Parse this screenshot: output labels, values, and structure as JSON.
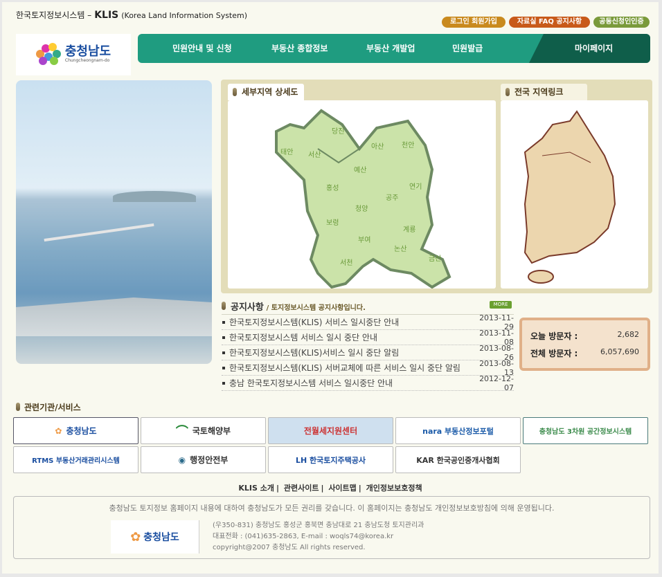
{
  "header": {
    "site_title_kr": "한국토지정보시스템 –",
    "site_title_en": "KLIS",
    "site_title_full": "(Korea Land Information System)",
    "top_buttons": [
      {
        "label": "로그인 회원가입",
        "color": "#c98a1e"
      },
      {
        "label": "자료실 FAQ 공지사항",
        "color": "#c85a1a"
      },
      {
        "label": "공동신청인인증",
        "color": "#7a9a3a"
      }
    ],
    "logo": {
      "name": "충청남도",
      "sub": "Chungcheongnam-do"
    }
  },
  "nav": {
    "items": [
      "민원안내 및 신청",
      "부동산 종합정보",
      "부동산 개발업",
      "민원발급"
    ],
    "mypage": "마이페이지"
  },
  "maps": {
    "detail_tab": "세부지역 상세도",
    "national_tab": "전국 지역링크",
    "regions": [
      "당진",
      "태안",
      "서산",
      "아산",
      "천안",
      "예산",
      "홍성",
      "연기",
      "공주",
      "청양",
      "보령",
      "계룡",
      "부여",
      "논산",
      "서천",
      "금산"
    ]
  },
  "notice": {
    "title": "공지사항",
    "subtitle": "/ 토지정보시스템 공지사항입니다.",
    "more": "MORE",
    "items": [
      {
        "title": "한국토지정보시스템(KLIS) 서비스 일시중단 안내",
        "date": "2013-11-29"
      },
      {
        "title": "한국토지정보시스템 서비스 일시 중단 안내",
        "date": "2013-11-08"
      },
      {
        "title": "한국토지정보시스템(KLIS)서비스 일시 중단 알림",
        "date": "2013-08-26"
      },
      {
        "title": "한국토지정보시스템(KLIS) 서버교체에 따른 서비스 일시 중단 알림",
        "date": "2013-08-13"
      },
      {
        "title": "충남 한국토지정보시스템 서비스 일시중단 안내",
        "date": "2012-12-07"
      }
    ]
  },
  "visitors": {
    "today_label": "오늘 방문자 :",
    "today": "2,682",
    "total_label": "전체 방문자 :",
    "total": "6,057,690"
  },
  "related": {
    "title": "관련기관/서비스",
    "items": [
      "충청남도",
      "국토해양부",
      "전월세지원센터",
      "nara 부동산정보포털",
      "충청남도 3차원 공간정보시스템",
      "RTMS 부동산거래관리시스템",
      "행정안전부",
      "LH 한국토지주택공사",
      "KAR 한국공인중개사협회"
    ]
  },
  "footer": {
    "links": [
      "KLIS 소개",
      "관련사이트",
      "사이트맵",
      "개인정보보호정책"
    ],
    "copy": "충청남도 토지정보 홈페이지 내용에 대하여 충청남도가 모든 권리를 갖습니다. 이 홈페이지는 충청남도 개인정보보호방침에 의해 운영됩니다.",
    "address": "(우350-831) 충청남도 홍성군 홍북면 충남대로 21 충남도청 토지관리과",
    "phone": "대표전화 : (041)635-2863, E-mail : woqls74@korea.kr",
    "copyright": "copyright@2007 충청남도 All rights reserved."
  }
}
